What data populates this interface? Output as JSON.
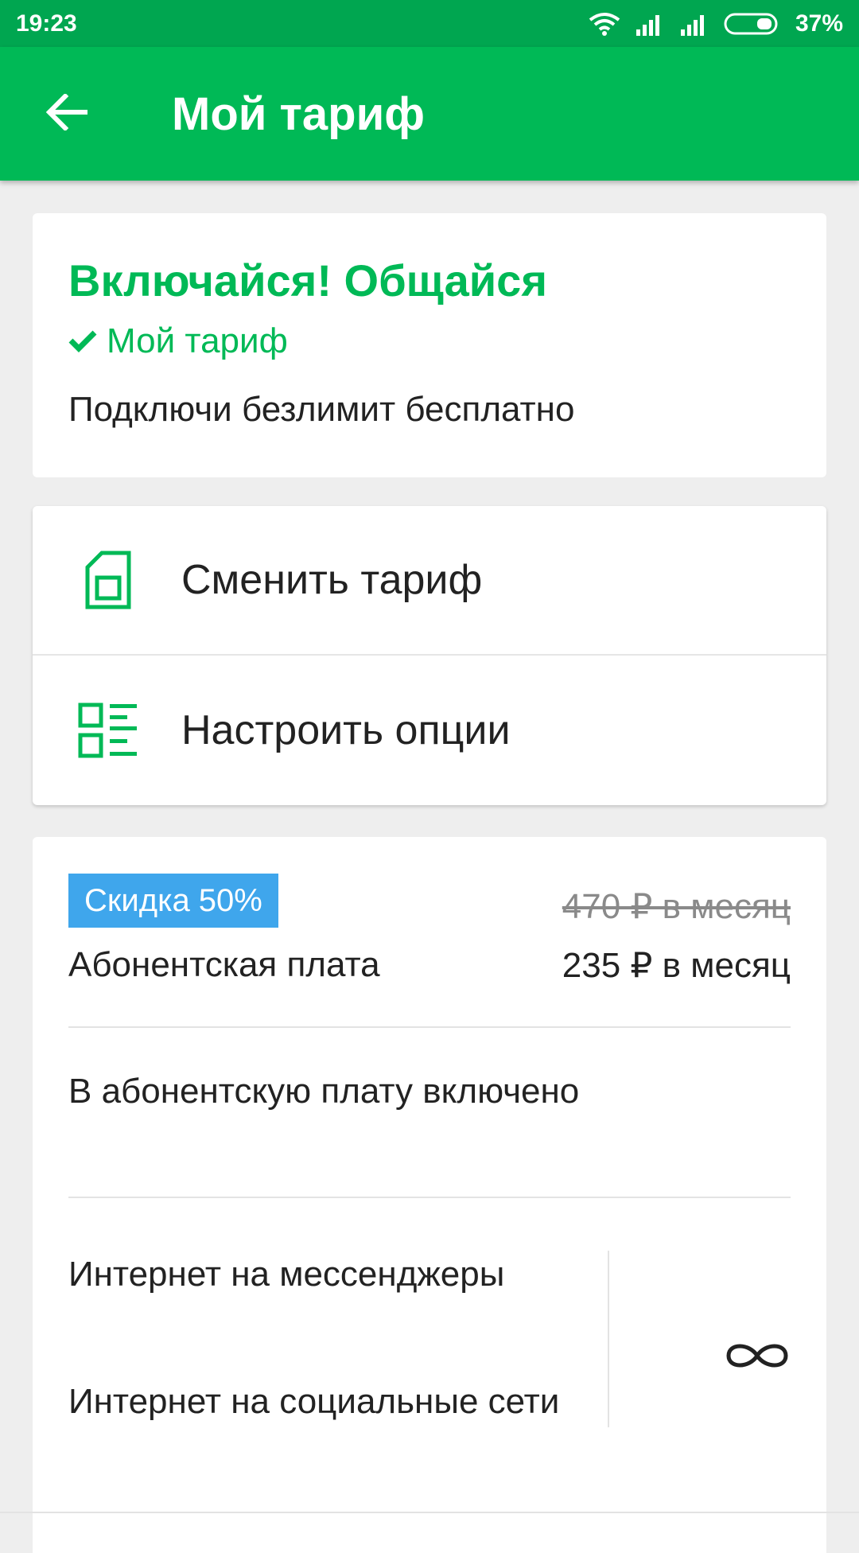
{
  "status_bar": {
    "time": "19:23",
    "battery": "37%",
    "icons": [
      "wifi-icon",
      "signal-icon",
      "signal-icon",
      "battery-icon"
    ]
  },
  "app_bar": {
    "title": "Мой тариф",
    "back_icon": "arrow-left-icon"
  },
  "tariff": {
    "name": "Включайся! Общайся",
    "badge": "Мой тариф",
    "description": "Подключи безлимит бесплатно"
  },
  "actions": [
    {
      "label": "Сменить тариф",
      "icon": "sim-card-icon"
    },
    {
      "label": "Настроить опции",
      "icon": "options-list-icon"
    }
  ],
  "fee": {
    "discount": "Скидка 50%",
    "old_price": "470 ₽ в месяц",
    "label": "Абонентская плата",
    "new_price": "235 ₽ в месяц"
  },
  "included": {
    "title": "В абонентскую плату включено",
    "items": [
      "Интернет на мессенджеры",
      "Интернет на социальные сети"
    ],
    "value_icon": "infinity-icon"
  },
  "colors": {
    "status_bar": "#00a650",
    "brand_green": "#00b956",
    "discount_blue": "#3fa6ec"
  }
}
